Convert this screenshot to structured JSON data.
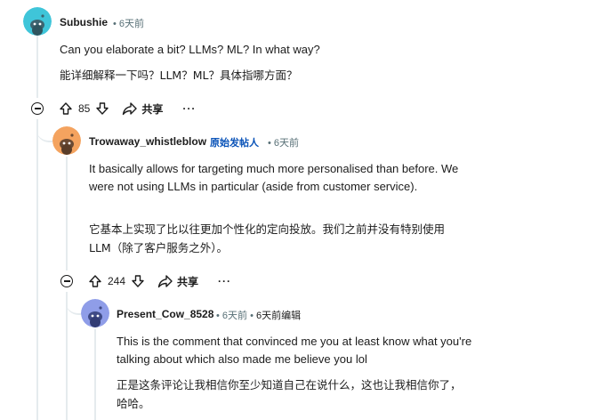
{
  "comments": [
    {
      "username": "Subushie",
      "time": "6天前",
      "body_en": "Can you elaborate a bit? LLMs? ML? In what way?",
      "body_zh": "能详细解释一下吗？LLM？ML？具体指哪方面？",
      "score": "85",
      "share_label": "共享",
      "more_label": "···",
      "avatar_color": "#3fc5d9"
    },
    {
      "username": "Trowaway_whistleblow",
      "op_tag": "原始发帖人",
      "time": "6天前",
      "body_en": "It basically allows for targeting much more personalised than before. We were not using LLMs in particular (aside from customer service).",
      "body_zh": "它基本上实现了比以往更加个性化的定向投放。我们之前并没有特别使用 LLM（除了客户服务之外）。",
      "score": "244",
      "share_label": "共享",
      "more_label": "···",
      "avatar_color": "#f4a35f"
    },
    {
      "username": "Present_Cow_8528",
      "time": "6天前",
      "edited": "6天前编辑",
      "body_en": "This is the comment that convinced me you at least know what you're talking about which also made me believe you lol",
      "body_zh": "正是这条评论让我相信你至少知道自己在说什么，这也让我相信你了，哈哈。",
      "avatar_color": "#8f9de8"
    }
  ],
  "separator": "•"
}
